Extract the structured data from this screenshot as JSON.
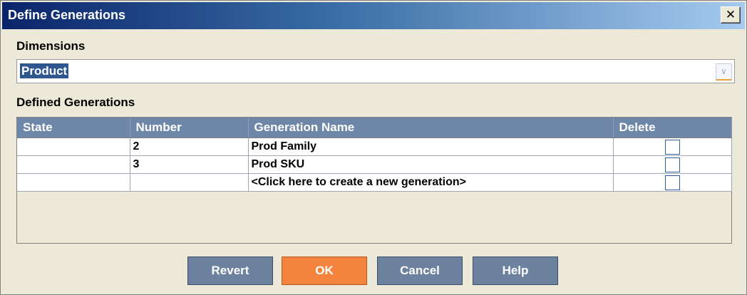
{
  "window": {
    "title": "Define Generations",
    "close_label": "✕"
  },
  "dimensions": {
    "label": "Dimensions",
    "selected": "Product"
  },
  "generations": {
    "label": "Defined Generations",
    "columns": [
      "State",
      "Number",
      "Generation Name",
      "Delete"
    ],
    "rows": [
      {
        "state": "",
        "number": "2",
        "name": "Prod Family"
      },
      {
        "state": "",
        "number": "3",
        "name": "Prod SKU"
      },
      {
        "state": "",
        "number": "",
        "name": "<Click here to create a new generation>"
      }
    ]
  },
  "buttons": {
    "revert": "Revert",
    "ok": "OK",
    "cancel": "Cancel",
    "help": "Help"
  },
  "colors": {
    "header_bg": "#6e87a8",
    "ok_bg": "#f4843d",
    "button_bg": "#6c829f",
    "selection": "#2f568f"
  }
}
